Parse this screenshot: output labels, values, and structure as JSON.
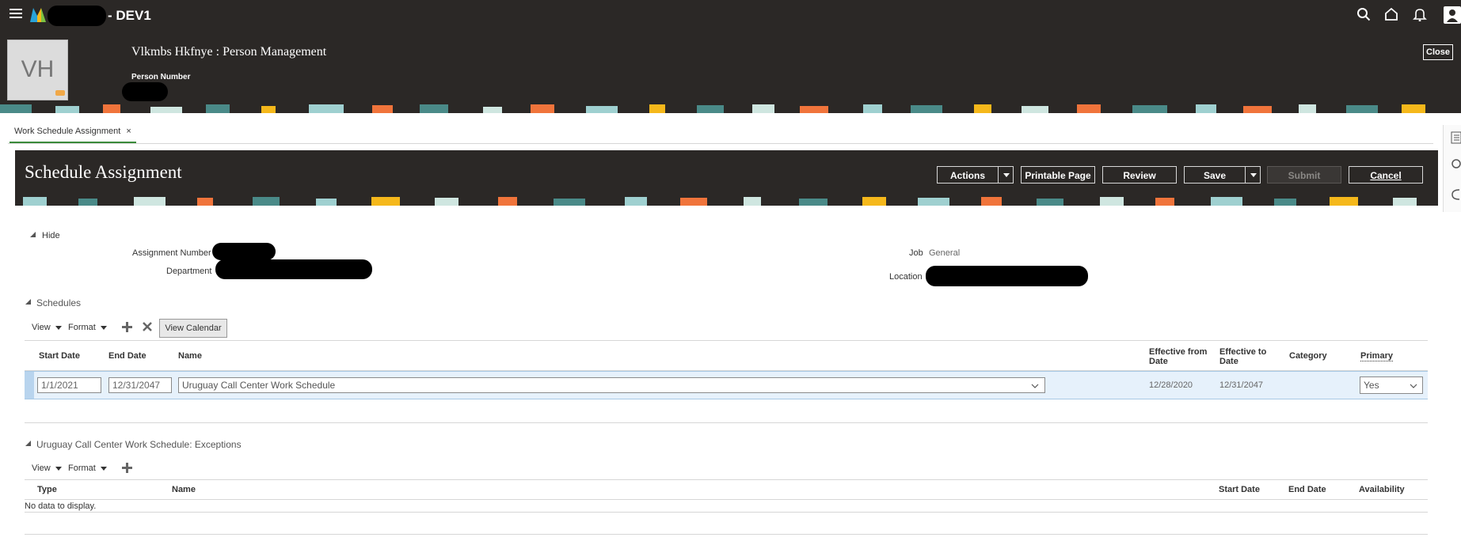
{
  "header": {
    "env_label": "- DEV1",
    "avatar_initials": "VH",
    "person_title": "Vlkmbs Hkfnye : Person Management",
    "person_number_label": "Person Number",
    "close_label": "Close"
  },
  "tab": {
    "label": "Work Schedule Assignment",
    "close": "×"
  },
  "page": {
    "title": "Schedule Assignment",
    "buttons": {
      "actions": "Actions",
      "printable": "Printable Page",
      "review": "Review",
      "save": "Save",
      "submit": "Submit",
      "cancel": "Cancel"
    }
  },
  "summary": {
    "hide_label": "Hide",
    "assignment_number_label": "Assignment Number",
    "department_label": "Department",
    "job_label": "Job",
    "job_value": "General",
    "location_label": "Location"
  },
  "schedules": {
    "section_title": "Schedules",
    "toolbar": {
      "view": "View",
      "format": "Format",
      "view_calendar": "View Calendar"
    },
    "columns": {
      "start_date": "Start Date",
      "end_date": "End Date",
      "name": "Name",
      "effective_from_1": "Effective from",
      "effective_from_2": "Date",
      "effective_to_1": "Effective to",
      "effective_to_2": "Date",
      "category": "Category",
      "primary": "Primary"
    },
    "row": {
      "start_date": "1/1/2021",
      "end_date": "12/31/2047",
      "name": "Uruguay Call Center Work Schedule",
      "effective_from": "12/28/2020",
      "effective_to": "12/31/2047",
      "category": "",
      "primary": "Yes"
    }
  },
  "exceptions": {
    "section_title": "Uruguay Call Center Work Schedule: Exceptions",
    "toolbar": {
      "view": "View",
      "format": "Format"
    },
    "columns": {
      "type": "Type",
      "name": "Name",
      "start_date": "Start Date",
      "end_date": "End Date",
      "availability": "Availability"
    },
    "empty_text": "No data to display."
  },
  "colors": {
    "header_bg": "#2b2826",
    "row_highlight": "#e6f1fb",
    "accent_orange": "#f0743b",
    "accent_teal": "#4a8a88"
  }
}
